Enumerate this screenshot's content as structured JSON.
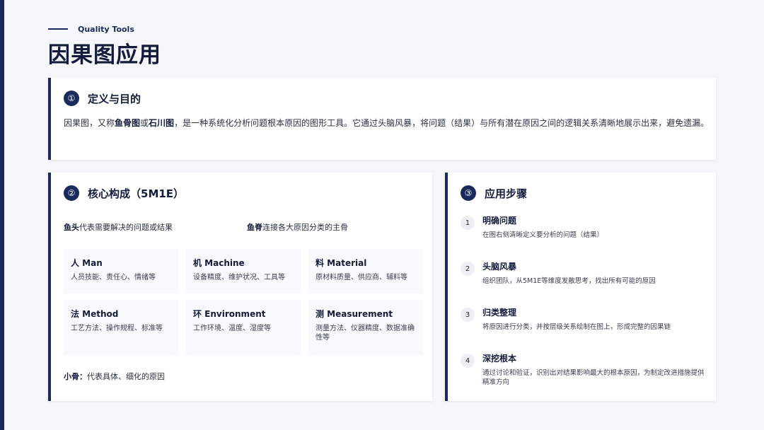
{
  "header": {
    "eyebrow": "Quality Tools",
    "title": "因果图应用"
  },
  "definition": {
    "badge": "①",
    "title": "定义与目的",
    "p1": "因果图，又称",
    "b1": "鱼骨图",
    "p2": "或",
    "b2": "石川图",
    "p3": "，是一种系统化分析问题根本原因的图形工具。它通过头脑风暴，将问题（结果）与所有潜在原因之间的逻辑关系清晰地展示出来，避免遗漏。"
  },
  "structure": {
    "badge": "②",
    "title": "核心构成（5M1E）",
    "head_term": "鱼头",
    "head_desc": "代表需要解决的问题或结果",
    "spine_term": "鱼脊",
    "spine_desc": "连接各大原因分类的主骨",
    "items": [
      {
        "title": "人 Man",
        "desc": "人员技能、责任心、情绪等"
      },
      {
        "title": "机 Machine",
        "desc": "设备精度、维护状况、工具等"
      },
      {
        "title": "料 Material",
        "desc": "原材料质量、供应商、辅料等"
      },
      {
        "title": "法 Method",
        "desc": "工艺方法、操作规程、标准等"
      },
      {
        "title": "环 Environment",
        "desc": "工作环境、温度、湿度等"
      },
      {
        "title": "测 Measurement",
        "desc": "测量方法、仪器精度、数据准确性等"
      }
    ],
    "bones_term": "小骨：",
    "bones_desc": "代表具体、细化的原因"
  },
  "steps": {
    "badge": "③",
    "title": "应用步骤",
    "items": [
      {
        "num": "1",
        "title": "明确问题",
        "desc": "在图右侧清晰定义要分析的问题（结果）"
      },
      {
        "num": "2",
        "title": "头脑风暴",
        "desc": "组织团队，从5M1E等维度发散思考，找出所有可能的原因"
      },
      {
        "num": "3",
        "title": "归类整理",
        "desc": "将原因进行分类，并按层级关系绘制在图上，形成完整的因果链"
      },
      {
        "num": "4",
        "title": "深挖根本",
        "desc": "通过讨论和验证，识别出对结果影响最大的根本原因，为制定改进措施提供精准方向"
      }
    ]
  }
}
